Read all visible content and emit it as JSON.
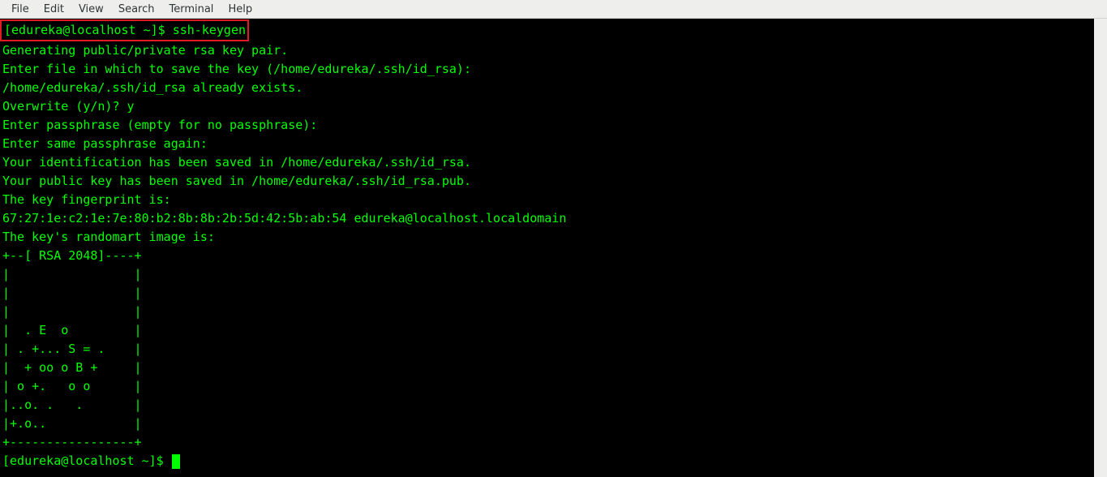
{
  "menubar": {
    "items": [
      "File",
      "Edit",
      "View",
      "Search",
      "Terminal",
      "Help"
    ]
  },
  "highlighted_command": "[edureka@localhost ~]$ ssh-keygen",
  "terminal_lines": [
    "Generating public/private rsa key pair.",
    "Enter file in which to save the key (/home/edureka/.ssh/id_rsa):",
    "/home/edureka/.ssh/id_rsa already exists.",
    "Overwrite (y/n)? y",
    "Enter passphrase (empty for no passphrase):",
    "Enter same passphrase again:",
    "Your identification has been saved in /home/edureka/.ssh/id_rsa.",
    "Your public key has been saved in /home/edureka/.ssh/id_rsa.pub.",
    "The key fingerprint is:",
    "67:27:1e:c2:1e:7e:80:b2:8b:8b:2b:5d:42:5b:ab:54 edureka@localhost.localdomain",
    "The key's randomart image is:",
    "+--[ RSA 2048]----+",
    "|                 |",
    "|                 |",
    "|                 |",
    "|  . E  o         |",
    "| . +... S = .    |",
    "|  + oo o B +     |",
    "| o +.   o o      |",
    "|..o. .   .       |",
    "|+.o..            |",
    "+-----------------+"
  ],
  "final_prompt": "[edureka@localhost ~]$ "
}
